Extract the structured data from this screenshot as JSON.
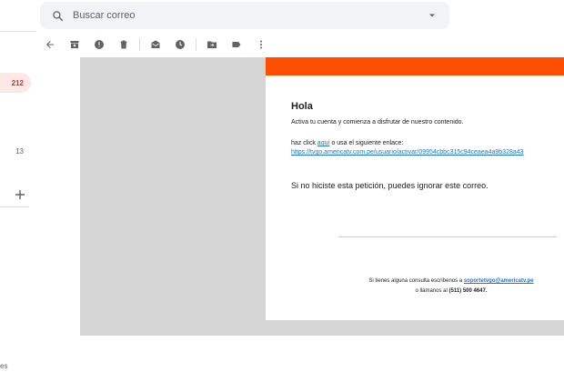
{
  "search": {
    "placeholder": "Buscar correo"
  },
  "sidebar": {
    "inbox_count": "212",
    "other_count": "13",
    "bottom_fragment": "es"
  },
  "email": {
    "greeting": "Hola",
    "intro": "Activa tu cuenta y comienza a disfrutar de nuestro contenido.",
    "click_prefix": "haz click",
    "click_link": "aquí",
    "click_suffix": "o usa el siguiente enlace:",
    "url": "https://tvgo.americatv.com.pe/usuario/activar/09954cbbc315c94ceaea4a9b328a43",
    "ignore_text": "Si no hiciste esta petición, puedes ignorar este correo.",
    "footer_prefix": "Si tienes alguna consulta escríbenos a",
    "footer_email": "soportetvgo@americatv.pe",
    "footer_call": "o llámanos al",
    "footer_phone": "(511) 500 4647."
  },
  "colors": {
    "brand_orange": "#ff4e00",
    "link_blue": "#1a73e8",
    "badge_bg": "#fce8e6",
    "badge_text": "#d93025"
  },
  "icons": {
    "search": "search-icon",
    "options": "caret-down-icon",
    "back": "arrow-left-icon",
    "archive": "archive-icon",
    "spam": "report-spam-icon",
    "delete": "trash-icon",
    "unread": "mark-unread-icon",
    "snooze": "clock-icon",
    "move": "folder-move-icon",
    "label": "label-icon",
    "more": "more-vert-icon",
    "add": "plus-icon"
  }
}
